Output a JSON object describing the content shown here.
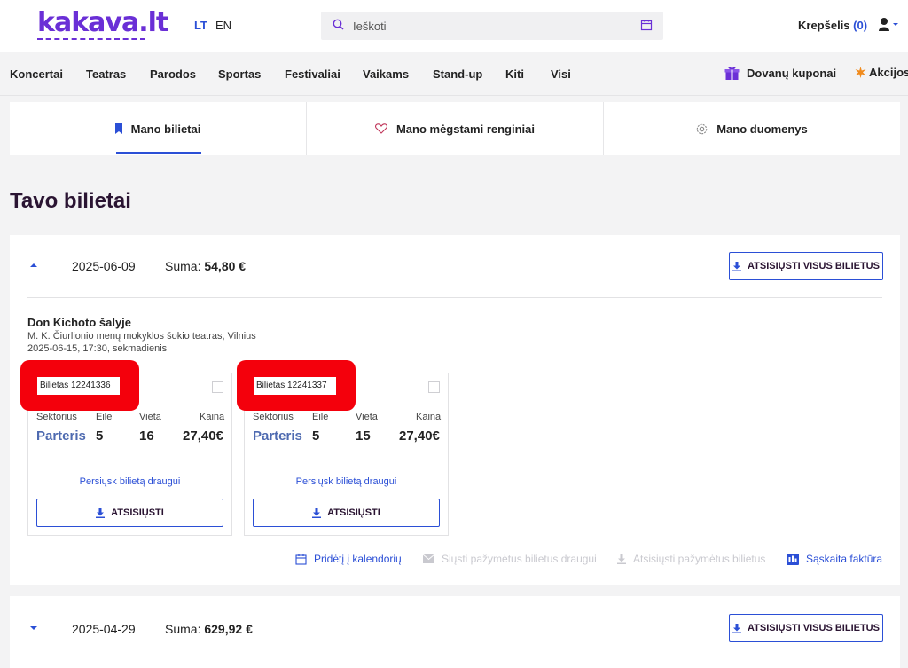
{
  "header": {
    "logo": "kakava.lt",
    "lang_lt": "LT",
    "lang_en": "EN",
    "search_placeholder": "Ieškoti",
    "cart_label": "Krepšelis",
    "cart_count": "(0)"
  },
  "nav": {
    "items": [
      "Koncertai",
      "Teatras",
      "Parodos",
      "Sportas",
      "Festivaliai",
      "Vaikams",
      "Stand-up",
      "Kiti",
      "Visi"
    ],
    "gift": "Dovanų kuponai",
    "promo": "Akcijos"
  },
  "tabs": [
    {
      "label": "Mano bilietai",
      "icon": "bookmark-icon",
      "active": true
    },
    {
      "label": "Mano mėgstami renginiai",
      "icon": "heart-icon",
      "active": false
    },
    {
      "label": "Mano duomenys",
      "icon": "gear-icon",
      "active": false
    }
  ],
  "page_title": "Tavo bilietai",
  "orders": [
    {
      "date": "2025-06-09",
      "sum_label": "Suma:",
      "sum": "54,80 €",
      "download_all": "ATSISIŲSTI VISUS BILIETUS",
      "expanded": true,
      "event": {
        "name": "Don Kichoto šalyje",
        "venue": "M. K. Čiurlionio menų mokyklos šokio teatras, Vilnius",
        "time": "2025-06-15, 17:30, sekmadienis"
      },
      "tickets": [
        {
          "id": "Bilietas 12241336",
          "sector": "Parteris",
          "row": "5",
          "seat": "16",
          "price": "27,40€"
        },
        {
          "id": "Bilietas 12241337",
          "sector": "Parteris",
          "row": "5",
          "seat": "15",
          "price": "27,40€"
        }
      ],
      "ticket_headers": {
        "sector": "Sektorius",
        "row": "Eilė",
        "seat": "Vieta",
        "price": "Kaina"
      },
      "send_friend": "Persiųsk bilietą draugui",
      "download": "ATSISIŲSTI",
      "actions": {
        "calendar": "Pridėtį į kalendorių",
        "send_selected": "Siųsti pažymėtus bilietus draugui",
        "download_selected": "Atsisiųsti pažymėtus bilietus",
        "invoice": "Sąskaita faktūra"
      }
    },
    {
      "date": "2025-04-29",
      "sum_label": "Suma:",
      "sum": "629,92 €",
      "download_all": "ATSISIŲSTI VISUS BILIETUS",
      "expanded": false
    }
  ],
  "colors": {
    "brand": "#6a2fd6",
    "accent": "#2b4fd6",
    "redaction": "#f4000c"
  }
}
